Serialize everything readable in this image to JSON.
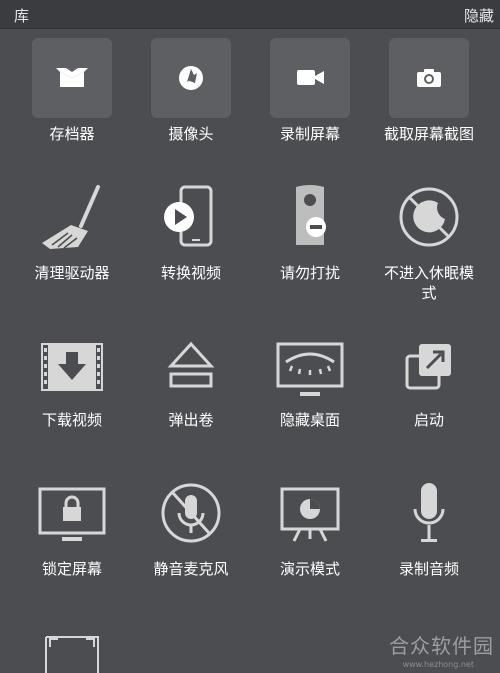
{
  "header": {
    "title": "库",
    "hide_label": "隐藏"
  },
  "tiles": [
    {
      "label": "存档器",
      "icon": "archiver-icon"
    },
    {
      "label": "摄像头",
      "icon": "camera-aperture-icon"
    },
    {
      "label": "录制屏幕",
      "icon": "video-camera-icon"
    },
    {
      "label": "截取屏幕截图",
      "icon": "photo-camera-icon"
    },
    {
      "label": "清理驱动器",
      "icon": "broom-icon"
    },
    {
      "label": "转换视频",
      "icon": "phone-play-icon"
    },
    {
      "label": "请勿打扰",
      "icon": "door-hanger-icon"
    },
    {
      "label": "不进入休眠模式",
      "label_line2": "式",
      "label_line1": "不进入休眠模",
      "icon": "no-sleep-icon"
    },
    {
      "label": "下载视频",
      "icon": "download-video-icon"
    },
    {
      "label": "弹出卷",
      "icon": "eject-icon"
    },
    {
      "label": "隐藏桌面",
      "icon": "hidden-eye-monitor-icon"
    },
    {
      "label": "启动",
      "icon": "launch-arrow-icon"
    },
    {
      "label": "锁定屏幕",
      "icon": "lock-monitor-icon"
    },
    {
      "label": "静音麦克风",
      "icon": "muted-mic-icon"
    },
    {
      "label": "演示模式",
      "icon": "presentation-icon"
    },
    {
      "label": "录制音频",
      "icon": "microphone-icon"
    }
  ],
  "watermark": {
    "text": "合众软件园",
    "sub": "www.hezhong.net"
  },
  "colors": {
    "background": "#4b4d51",
    "header": "#3a3c40",
    "tile_box": "#5d5f63"
  }
}
